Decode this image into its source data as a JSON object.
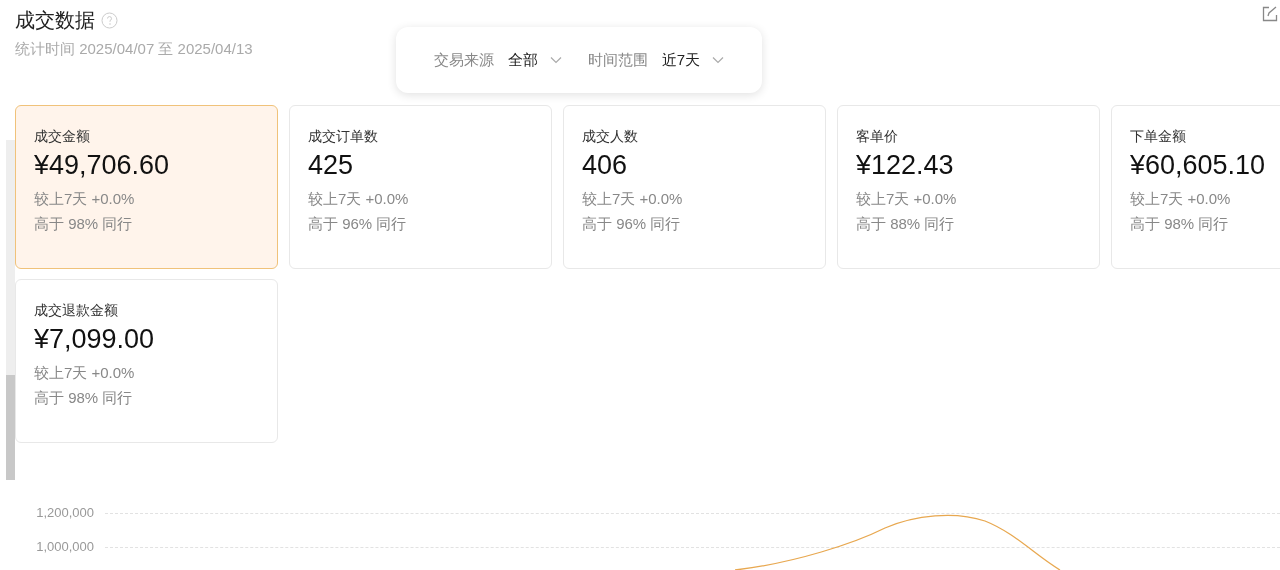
{
  "header": {
    "title": "成交数据",
    "period": "统计时间 2025/04/07 至 2025/04/13"
  },
  "filters": [
    {
      "label": "交易来源",
      "value": "全部"
    },
    {
      "label": "时间范围",
      "value": "近7天"
    }
  ],
  "cards": [
    {
      "title": "成交金额",
      "value": "¥49,706.60",
      "compare": "较上7天 +0.0%",
      "rank": "高于 98% 同行",
      "selected": true
    },
    {
      "title": "成交订单数",
      "value": "425",
      "compare": "较上7天 +0.0%",
      "rank": "高于 96% 同行",
      "selected": false
    },
    {
      "title": "成交人数",
      "value": "406",
      "compare": "较上7天 +0.0%",
      "rank": "高于 96% 同行",
      "selected": false
    },
    {
      "title": "客单价",
      "value": "¥122.43",
      "compare": "较上7天 +0.0%",
      "rank": "高于 88% 同行",
      "selected": false
    },
    {
      "title": "下单金额",
      "value": "¥60,605.10",
      "compare": "较上7天 +0.0%",
      "rank": "高于 98% 同行",
      "selected": false
    },
    {
      "title": "成交退款金额",
      "value": "¥7,099.00",
      "compare": "较上7天 +0.0%",
      "rank": "高于 98% 同行",
      "selected": false
    }
  ],
  "chart": {
    "y_axis_labels": [
      "1,200,000",
      "1,000,000"
    ]
  }
}
